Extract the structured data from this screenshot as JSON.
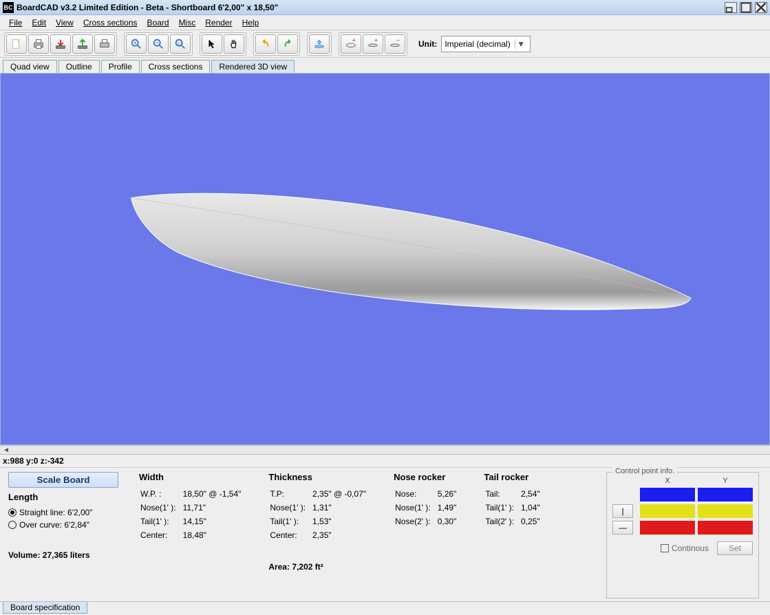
{
  "window": {
    "app_icon": "BC",
    "title": "BoardCAD v3.2 Limited Edition - Beta - Shortboard  6'2,00\" x 18,50\""
  },
  "menu": [
    "File",
    "Edit",
    "View",
    "Cross sections",
    "Board",
    "Misc",
    "Render",
    "Help"
  ],
  "toolbar": {
    "unit_label": "Unit:",
    "unit_value": "Imperial (decimal)"
  },
  "tabs": [
    "Quad view",
    "Outline",
    "Profile",
    "Cross sections",
    "Rendered 3D view"
  ],
  "active_tab": "Rendered 3D view",
  "coords": "x:988 y:0 z:-342",
  "spec": {
    "scale_label": "Scale Board",
    "length_header": "Length",
    "radio1_label": "Straight line: 6'2,00\"",
    "radio2_label": "Over curve: 6'2,84\"",
    "volume_label": "Volume: 27,365 liters",
    "width": {
      "header": "Width",
      "rows": [
        [
          "W.P. :",
          "18,50\" @ -1,54\""
        ],
        [
          "Nose(1' ):",
          "11,71\""
        ],
        [
          "Tail(1' ):",
          "14,15\""
        ],
        [
          "Center:",
          "18,48\""
        ]
      ]
    },
    "thickness": {
      "header": "Thickness",
      "rows": [
        [
          "T.P:",
          "2,35\" @ -0,07\""
        ],
        [
          "Nose(1' ):",
          "1,31\""
        ],
        [
          "Tail(1' ):",
          "1,53\""
        ],
        [
          "Center:",
          "2,35\""
        ]
      ],
      "area_label": "Area: 7,202 ft²"
    },
    "nose": {
      "header": "Nose rocker",
      "rows": [
        [
          "Nose:",
          "5,26\""
        ],
        [
          "Nose(1' ):",
          "1,49\""
        ],
        [
          "Nose(2' ):",
          "0,30\""
        ]
      ]
    },
    "tail": {
      "header": "Tail rocker",
      "rows": [
        [
          "Tail:",
          "2,54\""
        ],
        [
          "Tail(1' ):",
          "1,04\""
        ],
        [
          "Tail(2' ):",
          "0,25\""
        ]
      ]
    }
  },
  "cp": {
    "legend": "Control point info.",
    "x": "X",
    "y": "Y",
    "continuous": "Continous",
    "set": "Set",
    "vbar": "|",
    "hbar": "—"
  },
  "bottom_tab": "Board specification"
}
